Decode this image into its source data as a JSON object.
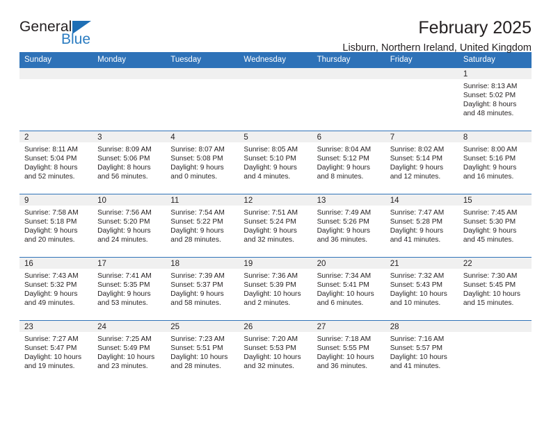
{
  "brand": {
    "name_top": "General",
    "name_bottom": "Blue",
    "accent_color": "#2b7cc1",
    "triangle_color": "#1f6fb5"
  },
  "header": {
    "title": "February 2025",
    "location": "Lisburn, Northern Ireland, United Kingdom",
    "header_bg_color": "#2e72b8",
    "daynum_bg_color": "#f0f0f0"
  },
  "weekdays": [
    "Sunday",
    "Monday",
    "Tuesday",
    "Wednesday",
    "Thursday",
    "Friday",
    "Saturday"
  ],
  "labels": {
    "sunrise": "Sunrise:",
    "sunset": "Sunset:",
    "daylight": "Daylight:"
  },
  "weeks": [
    [
      {
        "day": "",
        "empty": true
      },
      {
        "day": "",
        "empty": true
      },
      {
        "day": "",
        "empty": true
      },
      {
        "day": "",
        "empty": true
      },
      {
        "day": "",
        "empty": true
      },
      {
        "day": "",
        "empty": true
      },
      {
        "day": "1",
        "sunrise": "Sunrise: 8:13 AM",
        "sunset": "Sunset: 5:02 PM",
        "daylight_1": "Daylight: 8 hours",
        "daylight_2": "and 48 minutes."
      }
    ],
    [
      {
        "day": "2",
        "sunrise": "Sunrise: 8:11 AM",
        "sunset": "Sunset: 5:04 PM",
        "daylight_1": "Daylight: 8 hours",
        "daylight_2": "and 52 minutes."
      },
      {
        "day": "3",
        "sunrise": "Sunrise: 8:09 AM",
        "sunset": "Sunset: 5:06 PM",
        "daylight_1": "Daylight: 8 hours",
        "daylight_2": "and 56 minutes."
      },
      {
        "day": "4",
        "sunrise": "Sunrise: 8:07 AM",
        "sunset": "Sunset: 5:08 PM",
        "daylight_1": "Daylight: 9 hours",
        "daylight_2": "and 0 minutes."
      },
      {
        "day": "5",
        "sunrise": "Sunrise: 8:05 AM",
        "sunset": "Sunset: 5:10 PM",
        "daylight_1": "Daylight: 9 hours",
        "daylight_2": "and 4 minutes."
      },
      {
        "day": "6",
        "sunrise": "Sunrise: 8:04 AM",
        "sunset": "Sunset: 5:12 PM",
        "daylight_1": "Daylight: 9 hours",
        "daylight_2": "and 8 minutes."
      },
      {
        "day": "7",
        "sunrise": "Sunrise: 8:02 AM",
        "sunset": "Sunset: 5:14 PM",
        "daylight_1": "Daylight: 9 hours",
        "daylight_2": "and 12 minutes."
      },
      {
        "day": "8",
        "sunrise": "Sunrise: 8:00 AM",
        "sunset": "Sunset: 5:16 PM",
        "daylight_1": "Daylight: 9 hours",
        "daylight_2": "and 16 minutes."
      }
    ],
    [
      {
        "day": "9",
        "sunrise": "Sunrise: 7:58 AM",
        "sunset": "Sunset: 5:18 PM",
        "daylight_1": "Daylight: 9 hours",
        "daylight_2": "and 20 minutes."
      },
      {
        "day": "10",
        "sunrise": "Sunrise: 7:56 AM",
        "sunset": "Sunset: 5:20 PM",
        "daylight_1": "Daylight: 9 hours",
        "daylight_2": "and 24 minutes."
      },
      {
        "day": "11",
        "sunrise": "Sunrise: 7:54 AM",
        "sunset": "Sunset: 5:22 PM",
        "daylight_1": "Daylight: 9 hours",
        "daylight_2": "and 28 minutes."
      },
      {
        "day": "12",
        "sunrise": "Sunrise: 7:51 AM",
        "sunset": "Sunset: 5:24 PM",
        "daylight_1": "Daylight: 9 hours",
        "daylight_2": "and 32 minutes."
      },
      {
        "day": "13",
        "sunrise": "Sunrise: 7:49 AM",
        "sunset": "Sunset: 5:26 PM",
        "daylight_1": "Daylight: 9 hours",
        "daylight_2": "and 36 minutes."
      },
      {
        "day": "14",
        "sunrise": "Sunrise: 7:47 AM",
        "sunset": "Sunset: 5:28 PM",
        "daylight_1": "Daylight: 9 hours",
        "daylight_2": "and 41 minutes."
      },
      {
        "day": "15",
        "sunrise": "Sunrise: 7:45 AM",
        "sunset": "Sunset: 5:30 PM",
        "daylight_1": "Daylight: 9 hours",
        "daylight_2": "and 45 minutes."
      }
    ],
    [
      {
        "day": "16",
        "sunrise": "Sunrise: 7:43 AM",
        "sunset": "Sunset: 5:32 PM",
        "daylight_1": "Daylight: 9 hours",
        "daylight_2": "and 49 minutes."
      },
      {
        "day": "17",
        "sunrise": "Sunrise: 7:41 AM",
        "sunset": "Sunset: 5:35 PM",
        "daylight_1": "Daylight: 9 hours",
        "daylight_2": "and 53 minutes."
      },
      {
        "day": "18",
        "sunrise": "Sunrise: 7:39 AM",
        "sunset": "Sunset: 5:37 PM",
        "daylight_1": "Daylight: 9 hours",
        "daylight_2": "and 58 minutes."
      },
      {
        "day": "19",
        "sunrise": "Sunrise: 7:36 AM",
        "sunset": "Sunset: 5:39 PM",
        "daylight_1": "Daylight: 10 hours",
        "daylight_2": "and 2 minutes."
      },
      {
        "day": "20",
        "sunrise": "Sunrise: 7:34 AM",
        "sunset": "Sunset: 5:41 PM",
        "daylight_1": "Daylight: 10 hours",
        "daylight_2": "and 6 minutes."
      },
      {
        "day": "21",
        "sunrise": "Sunrise: 7:32 AM",
        "sunset": "Sunset: 5:43 PM",
        "daylight_1": "Daylight: 10 hours",
        "daylight_2": "and 10 minutes."
      },
      {
        "day": "22",
        "sunrise": "Sunrise: 7:30 AM",
        "sunset": "Sunset: 5:45 PM",
        "daylight_1": "Daylight: 10 hours",
        "daylight_2": "and 15 minutes."
      }
    ],
    [
      {
        "day": "23",
        "sunrise": "Sunrise: 7:27 AM",
        "sunset": "Sunset: 5:47 PM",
        "daylight_1": "Daylight: 10 hours",
        "daylight_2": "and 19 minutes."
      },
      {
        "day": "24",
        "sunrise": "Sunrise: 7:25 AM",
        "sunset": "Sunset: 5:49 PM",
        "daylight_1": "Daylight: 10 hours",
        "daylight_2": "and 23 minutes."
      },
      {
        "day": "25",
        "sunrise": "Sunrise: 7:23 AM",
        "sunset": "Sunset: 5:51 PM",
        "daylight_1": "Daylight: 10 hours",
        "daylight_2": "and 28 minutes."
      },
      {
        "day": "26",
        "sunrise": "Sunrise: 7:20 AM",
        "sunset": "Sunset: 5:53 PM",
        "daylight_1": "Daylight: 10 hours",
        "daylight_2": "and 32 minutes."
      },
      {
        "day": "27",
        "sunrise": "Sunrise: 7:18 AM",
        "sunset": "Sunset: 5:55 PM",
        "daylight_1": "Daylight: 10 hours",
        "daylight_2": "and 36 minutes."
      },
      {
        "day": "28",
        "sunrise": "Sunrise: 7:16 AM",
        "sunset": "Sunset: 5:57 PM",
        "daylight_1": "Daylight: 10 hours",
        "daylight_2": "and 41 minutes."
      },
      {
        "day": "",
        "empty": true
      }
    ]
  ]
}
